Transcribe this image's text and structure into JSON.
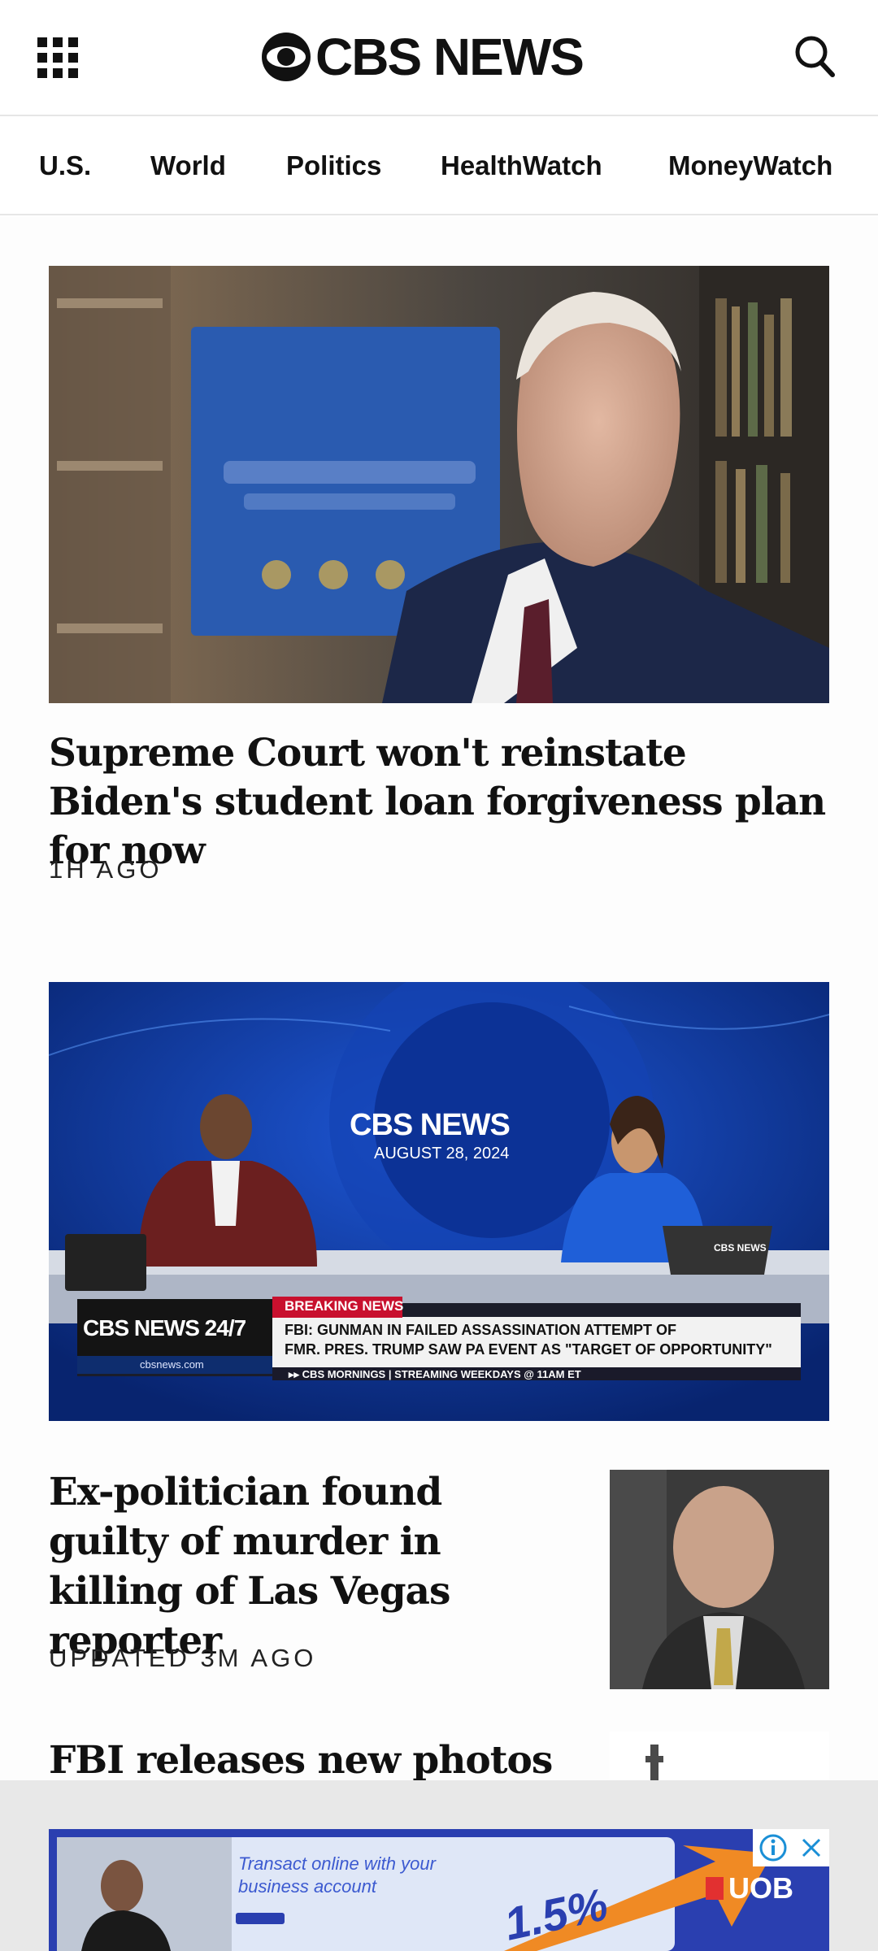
{
  "header": {
    "logo_text": "CBS NEWS"
  },
  "nav": {
    "items": [
      "U.S.",
      "World",
      "Politics",
      "HealthWatch",
      "MoneyWatch"
    ]
  },
  "stories": [
    {
      "headline": "Supreme Court won't reinstate Biden's student loan forgiveness plan for now",
      "timestamp": "1H AGO"
    },
    {
      "headline": "Ex-politician found guilty of murder in killing of Las Vegas reporter",
      "timestamp": "UPDATED 3M AGO"
    },
    {
      "headline": "FBI releases new photos"
    }
  ],
  "video": {
    "logo": "CBS NEWS",
    "date": "AUGUST 28, 2024",
    "channel": "CBS NEWS 24/7",
    "site": "cbsnews.com",
    "breaking_label": "BREAKING NEWS",
    "breaking_line1": "FBI: GUNMAN IN FAILED ASSASSINATION ATTEMPT OF",
    "breaking_line2": "FMR. PRES. TRUMP SAW PA EVENT AS \"TARGET OF OPPORTUNITY\"",
    "ticker": "▸▸ CBS MORNINGS | STREAMING WEEKDAYS @ 11AM ET",
    "desk_logo": "CBS NEWS"
  },
  "ad": {
    "line1": "Transact online with your",
    "line2": "business account",
    "rate": "1.5%",
    "brand": "UOB"
  },
  "colors": {
    "breaking_red": "#c8102e",
    "ad_blue": "#2a3fb0",
    "ad_orange": "#f08a24"
  }
}
